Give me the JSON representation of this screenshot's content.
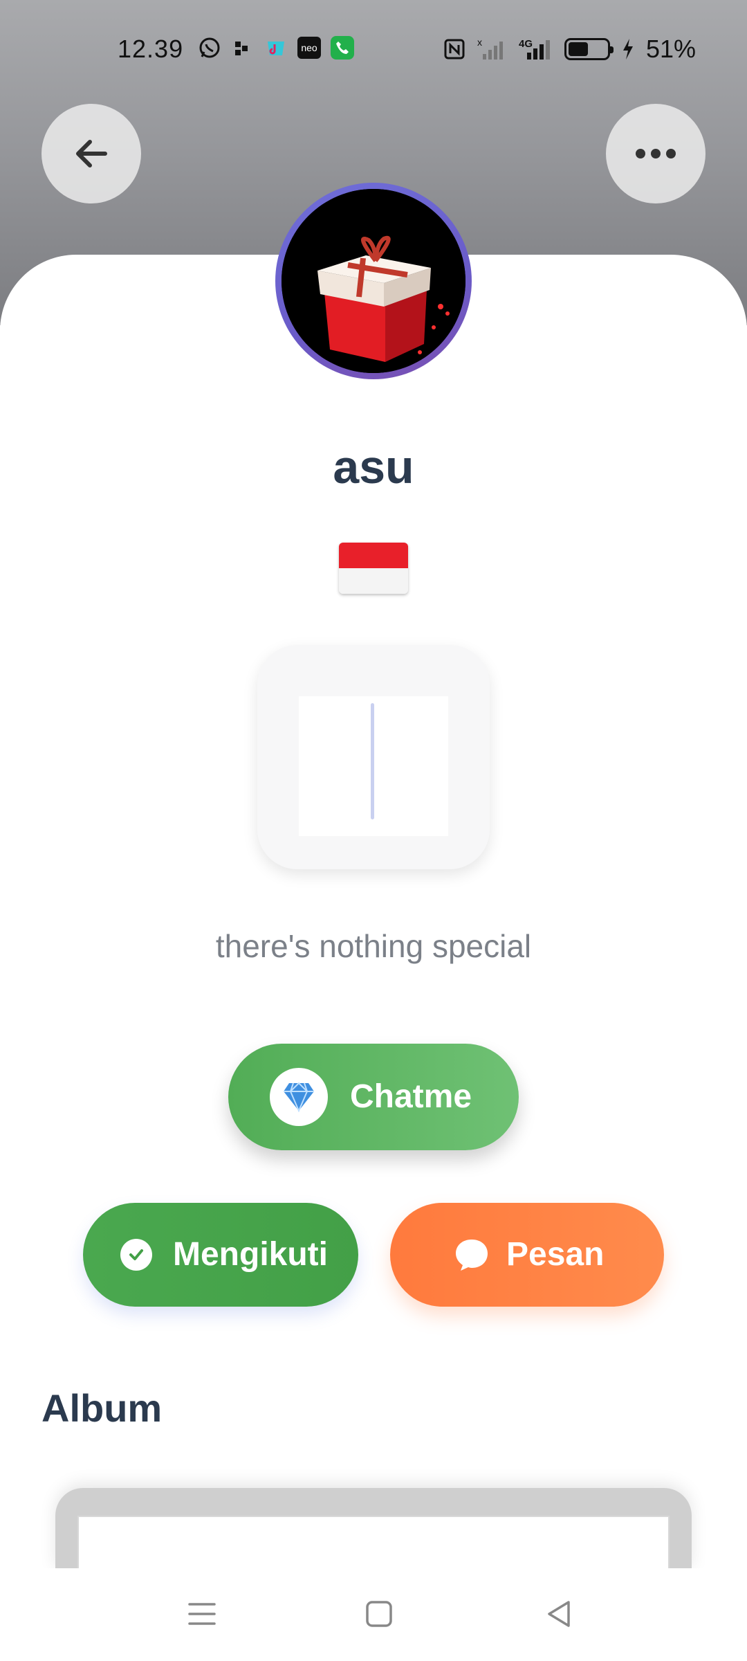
{
  "status_bar": {
    "time": "12.39",
    "network": "4G",
    "battery_percent": "51%",
    "battery_level": 0.51,
    "left_icons": [
      "whatsapp-icon",
      "app-dots-icon",
      "tiktok-shop-icon",
      "neo-icon",
      "phone-icon"
    ],
    "neo_label": "neo",
    "right_icons": [
      "nfc-icon",
      "signal-off-icon",
      "signal-4g-icon",
      "battery-icon",
      "charging-icon"
    ]
  },
  "header": {
    "back_icon": "arrow-left-icon",
    "more_icon": "more-horizontal-icon"
  },
  "profile": {
    "username": "asu",
    "flag": "indonesia-flag",
    "bio": "there's nothing special",
    "avatar_icon": "gift-box-icon"
  },
  "actions": {
    "chatme_label": "Chatme",
    "chatme_icon": "diamond-icon",
    "follow_label": "Mengikuti",
    "follow_icon": "check-circle-icon",
    "message_label": "Pesan",
    "message_icon": "chat-bubble-icon"
  },
  "album": {
    "title": "Album"
  },
  "colors": {
    "primary_green": "#52ad56",
    "accent_orange": "#ff7a3d",
    "avatar_ring": "#6a5bc8",
    "text_dark": "#2b3a4e",
    "text_muted": "#7b8088"
  },
  "nav_bar": {
    "icons": [
      "menu-icon",
      "home-square-icon",
      "back-triangle-icon"
    ]
  }
}
